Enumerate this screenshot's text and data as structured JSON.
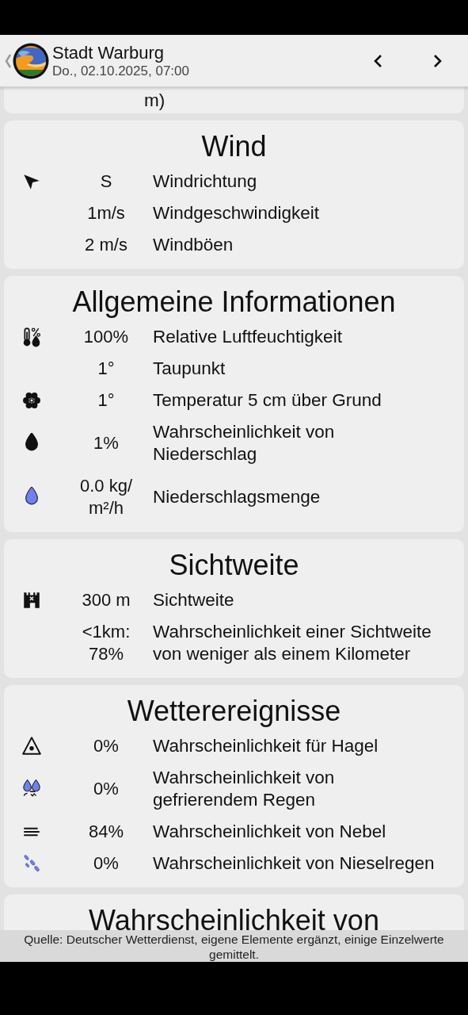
{
  "header": {
    "title": "Stadt Warburg",
    "subtitle": "Do., 02.10.2025, 07:00"
  },
  "partial_card": {
    "label": "m)"
  },
  "sections": [
    {
      "title": "Wind",
      "rows": [
        {
          "kind": "direction",
          "value": "S",
          "label": "Windrichtung"
        },
        {
          "kind": "plain",
          "value": "1m/s",
          "label": "Windgeschwindigkeit"
        },
        {
          "kind": "plain",
          "value": "2 m/s",
          "label": "Windböen"
        }
      ]
    },
    {
      "title": "Allgemeine Informationen",
      "rows": [
        {
          "kind": "humidity",
          "value": "100%",
          "label": "Relative Luftfeuchtigkeit"
        },
        {
          "kind": "plain",
          "value": "1°",
          "label": "Taupunkt"
        },
        {
          "kind": "ground",
          "value": "1°",
          "label": "Temperatur 5 cm über Grund"
        },
        {
          "kind": "rainchance",
          "value": "1%",
          "label": "Wahrscheinlichkeit von Niederschlag"
        },
        {
          "kind": "rainamount",
          "value": "0.0 kg/ m²/h",
          "label": "Niederschlagsmenge"
        }
      ]
    },
    {
      "title": "Sichtweite",
      "rows": [
        {
          "kind": "visibility",
          "value": "300 m",
          "label": "Sichtweite"
        },
        {
          "kind": "plain",
          "value": "<1km: 78%",
          "label": "Wahrscheinlichkeit einer Sichtweite von weniger als einem Kilometer"
        }
      ]
    },
    {
      "title": "Wetterereignisse",
      "rows": [
        {
          "kind": "hail",
          "value": "0%",
          "label": "Wahrscheinlichkeit für Hagel"
        },
        {
          "kind": "freezing",
          "value": "0%",
          "label": "Wahrscheinlichkeit von gefrierendem Regen"
        },
        {
          "kind": "fog",
          "value": "84%",
          "label": "Wahrscheinlichkeit von Nebel"
        },
        {
          "kind": "drizzle",
          "value": "0%",
          "label": "Wahrscheinlichkeit von Nieselregen"
        }
      ]
    },
    {
      "title": "Wahrscheinlichkeit von"
    }
  ],
  "footer": "Quelle: Deutscher Wetterdienst, eigene Elemente ergänzt, einige Einzelwerte gemittelt."
}
